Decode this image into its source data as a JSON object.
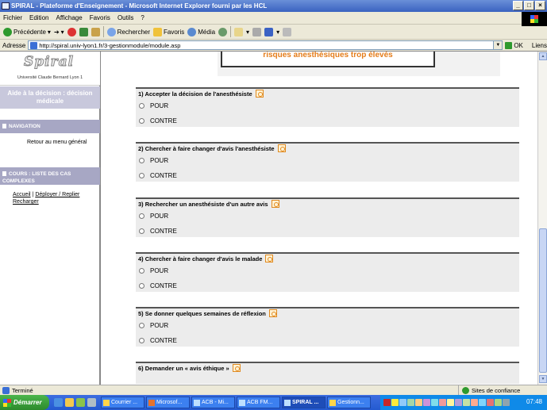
{
  "window": {
    "title": "SPIRAL - Plateforme d'Enseignement - Microsoft Internet Explorer fourni par les HCL",
    "buttons": [
      "_",
      "□",
      "×"
    ]
  },
  "menu": [
    "Fichier",
    "Edition",
    "Affichage",
    "Favoris",
    "Outils",
    "?"
  ],
  "toolbar": {
    "back": "Précédente",
    "search": "Rechercher",
    "favorites": "Favoris",
    "media": "Média"
  },
  "address": {
    "label": "Adresse",
    "url": "http://spiral.univ-lyon1.fr/3-gestionmodule/module.asp",
    "go": "OK",
    "links": "Liens"
  },
  "sidebar": {
    "logo": "Spiral",
    "university": "Université Claude Bernard Lyon 1",
    "course_title": "Aide à la décision : décision médicale",
    "navigation_header": "NAVIGATION",
    "back_link": "Retour au menu général",
    "courses_header": "COURS : LISTE DES CAS COMPLEXES",
    "home_link": "Accueil",
    "sep": "|",
    "expand_link": "Déployer / Replier",
    "reload_link": "Recharger"
  },
  "main": {
    "banner": "risques anesthésiques trop élevés",
    "questions": [
      {
        "label": "1) Accepter la décision de l'anesthésiste",
        "options": [
          "POUR",
          "CONTRE"
        ]
      },
      {
        "label": "2) Chercher à faire changer d'avis l'anesthésiste",
        "options": [
          "POUR",
          "CONTRE"
        ]
      },
      {
        "label": "3) Rechercher un anesthésiste d'un autre avis",
        "options": [
          "POUR",
          "CONTRE"
        ]
      },
      {
        "label": "4) Chercher à faire changer d'avis le malade",
        "options": [
          "POUR",
          "CONTRE"
        ]
      },
      {
        "label": "5) Se donner quelques semaines de réflexion",
        "options": [
          "POUR",
          "CONTRE"
        ]
      },
      {
        "label": "6) Demander un « avis éthique »",
        "options": []
      }
    ]
  },
  "status": {
    "left": "Terminé",
    "right": "Sites de confiance"
  },
  "taskbar": {
    "start": "Démarrer",
    "tasks": [
      "Courrier ...",
      "Microsof...",
      "ACB - Mi...",
      "ACB FM...",
      "SPIRAL ...",
      "Gestionn..."
    ],
    "clock": "07:48"
  }
}
